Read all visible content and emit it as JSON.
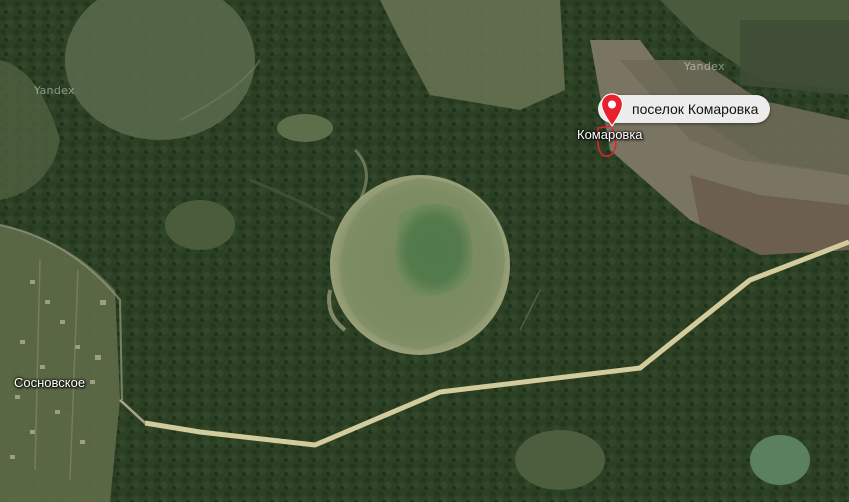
{
  "map": {
    "watermarks": [
      "Yandex",
      "Yandex"
    ],
    "place_labels": {
      "komarovka": "Комаровка",
      "sosnovskoe": "Сосновское"
    },
    "pin": {
      "label": "поселок Комаровка",
      "icon": "map-pin-icon",
      "color": "#e8212f"
    },
    "colors": {
      "forest": "#2e4226",
      "meadow": "#5a6a45",
      "road": "#cfc89a",
      "water": "#4e7048"
    }
  }
}
